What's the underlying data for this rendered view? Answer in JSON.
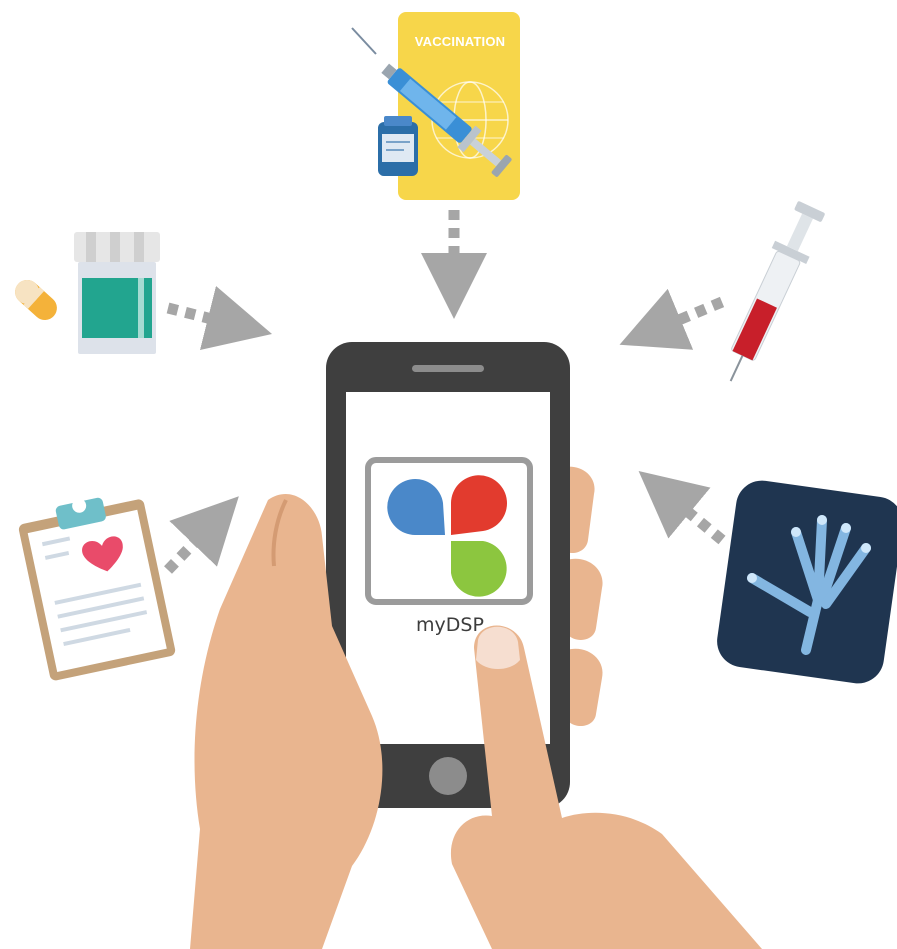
{
  "vaccination_card": {
    "label": "VACCINATION"
  },
  "app": {
    "name": "myDSP"
  },
  "icons": [
    "pill-icon",
    "medicine-bottle-icon",
    "vaccination-card-icon",
    "syringe-icon",
    "blood-syringe-icon",
    "medical-clipboard-icon",
    "xray-hand-icon",
    "smartphone-icon",
    "app-logo-icon"
  ],
  "colors": {
    "arrow": "#a6a6a6",
    "phone_body": "#3f3f3f",
    "logo_blue": "#4a88c9",
    "logo_red": "#e23b2e",
    "logo_green": "#8cc63f",
    "card_yellow": "#f7d64a",
    "skin": "#e9b58f"
  }
}
